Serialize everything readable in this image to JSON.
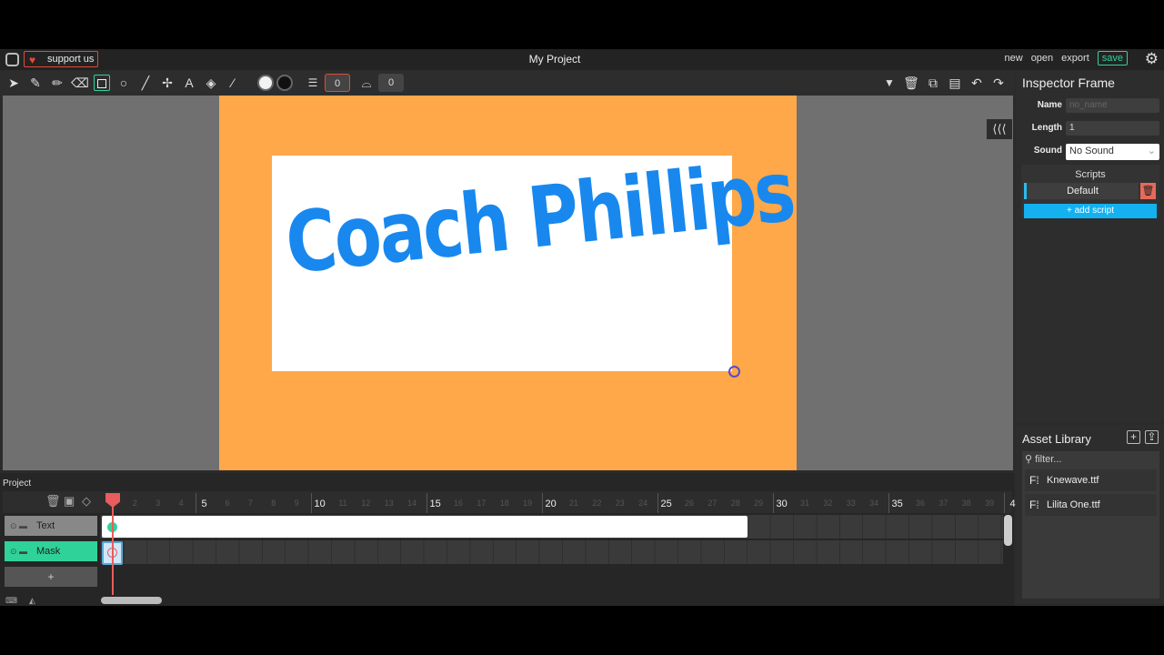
{
  "menubar": {
    "support_label": "support us",
    "project_title": "My Project",
    "links": [
      "new",
      "open",
      "export"
    ],
    "save_label": "save"
  },
  "toolbar": {
    "tools": [
      "cursor-icon",
      "brush-icon",
      "pencil-icon",
      "eraser-icon",
      "rectangle-icon",
      "ellipse-icon",
      "line-icon",
      "path-icon",
      "text-icon",
      "fill-icon",
      "eyedropper-icon"
    ],
    "stroke_width": "0",
    "rotation_value": "0"
  },
  "canvas": {
    "text": "Coach Phillips",
    "background_color": "#fea849",
    "text_color": "#1888ee"
  },
  "inspector": {
    "title": "Inspector Frame",
    "name_label": "Name",
    "name_placeholder": "no_name",
    "length_label": "Length",
    "length_value": "1",
    "sound_label": "Sound",
    "sound_value": "No Sound",
    "scripts_title": "Scripts",
    "script_name": "Default",
    "add_script_label": "+ add script"
  },
  "assets": {
    "title": "Asset Library",
    "filter_placeholder": "filter...",
    "items": [
      "Knewave.ttf",
      "Lilita One.ttf"
    ]
  },
  "timeline": {
    "tab_label": "Project",
    "layers": [
      "Text",
      "Mask"
    ],
    "add_layer_label": "+",
    "ruler_major": [
      "5",
      "10",
      "15",
      "20",
      "25",
      "30",
      "35",
      "4"
    ],
    "ruler_minor": [
      "2",
      "3",
      "4",
      "6",
      "7",
      "8",
      "9",
      "11",
      "12",
      "13",
      "14",
      "16",
      "17",
      "18",
      "19",
      "21",
      "22",
      "23",
      "24",
      "26",
      "27",
      "28",
      "29",
      "31",
      "32",
      "33",
      "34",
      "36",
      "37",
      "38",
      "39"
    ]
  }
}
